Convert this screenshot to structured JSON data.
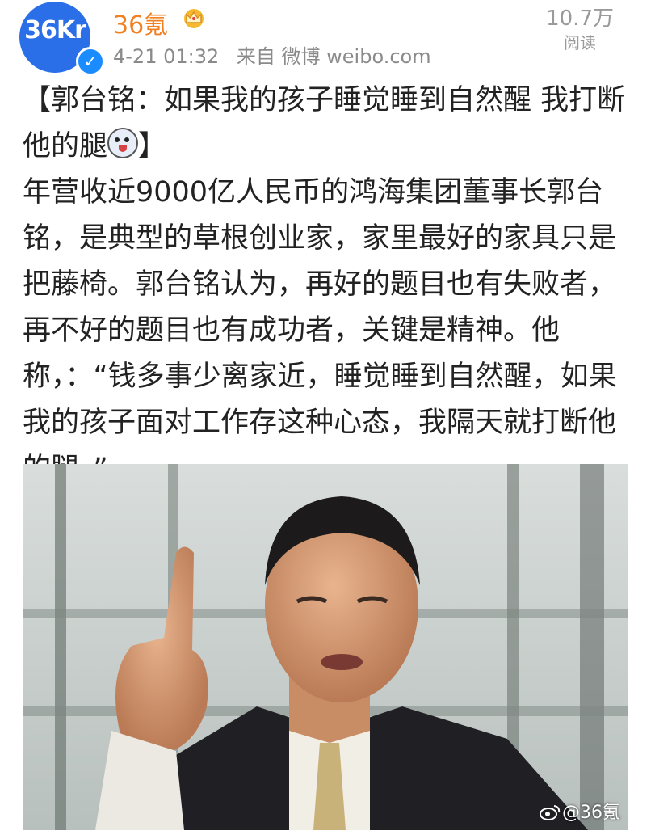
{
  "author": {
    "avatar_text": "36Kr",
    "name": "36氪",
    "verified_icon": "verified-check-icon",
    "crown_icon": "crown-icon"
  },
  "meta": {
    "time": "4-21 01:32",
    "source": "来自 微博 weibo.com"
  },
  "views": {
    "count": "10.7万",
    "label": "阅读"
  },
  "post": {
    "title": "【郭台铭：如果我的孩子睡觉睡到自然醒 我打断他的腿",
    "title_end": "】",
    "body": "年营收近9000亿人民币的鸿海集团董事长郭台铭，是典型的草根创业家，家里最好的家具只是把藤椅。郭台铭认为，再好的题目也有失败者，再不好的题目也有成功者，关键是精神。他称，：“钱多事少离家近，睡觉睡到自然醒，如果我的孩子面对工作存这种心态，我隔天就打断他的腿。”"
  },
  "image": {
    "watermark": "@36氪"
  },
  "colors": {
    "name": "#f08020",
    "avatar": "#2a6fe8",
    "meta": "#8a8a8a"
  }
}
